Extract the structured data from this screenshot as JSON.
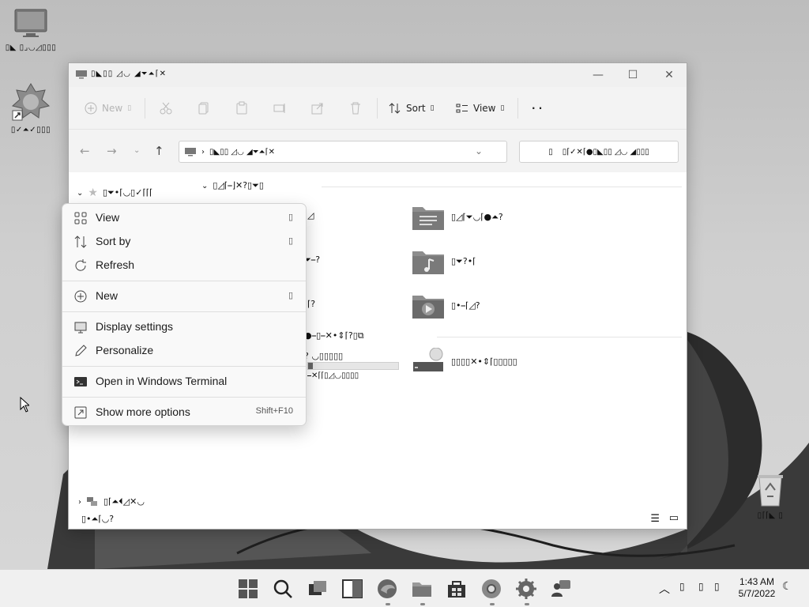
{
  "desktop": {
    "icons": [
      {
        "label": "▯◣ ▯⌟◡◿▯▯▯",
        "name": "this-pc"
      },
      {
        "label": "▯✓⏶✓▯▯▯",
        "name": "user-folder"
      },
      {
        "label": "▯⌈⌈◣ ▯",
        "name": "recycle-bin"
      }
    ]
  },
  "window": {
    "title": "▯◣▯▯ ◿◡ ◢⏷⏶⌈✕",
    "controls": {
      "minimize": "—",
      "maximize": "☐",
      "close": "✕"
    }
  },
  "commandbar": {
    "new_label": "New",
    "new_suffix": "▯",
    "sort_label": "Sort",
    "sort_suffix": "▯",
    "view_label": "View",
    "view_suffix": "▯",
    "more": "· ·"
  },
  "addressbar": {
    "path": "▯◣▯▯ ◿◡ ◢⏷⏶⌈✕",
    "search_placeholder": "▯⌈✓✕⌈●▯◣▯▯ ◿◡ ◢▯▯▯"
  },
  "navpane": {
    "quick_access": "▯⏷•⌈◡▯✓⌈⌈⌈",
    "network": "▯⌈⏶⏴◿✕◡"
  },
  "sections": {
    "folders_header": "▯◿⌈⎯⌋✕?▯⏷▯",
    "drives_header": "●⎯▯⎯✕•⇕⌈?▯⧉",
    "status": "▯•⏶⌈◡?"
  },
  "folders": [
    {
      "name": "▯◿⌈⏷◡⌈●⏶?",
      "icon": "documents-folder-icon"
    },
    {
      "name": "▯⏷?•⌈",
      "icon": "music-folder-icon"
    },
    {
      "name": "▯•⎯⌈◿?",
      "icon": "videos-folder-icon"
    }
  ],
  "partial_left_items": [
    {
      "text": "◿"
    },
    {
      "text": "⏷⎯?"
    },
    {
      "text": "⌈?"
    }
  ],
  "drives": [
    {
      "name": "? ◡▯▯▯▯▯",
      "detail": "⎯✕⌈⌈▯◿◡▯▯▯▯",
      "usage": 0.05
    },
    {
      "name": "▯▯▯▯✕•⇕⌈▯▯▯▯▯",
      "icon": "dvd-drive-icon"
    }
  ],
  "context_menu": {
    "items": [
      {
        "label": "View",
        "right": "▯",
        "icon": "grid-icon"
      },
      {
        "label": "Sort by",
        "right": "▯",
        "icon": "sort-icon"
      },
      {
        "label": "Refresh",
        "right": "",
        "icon": "refresh-icon"
      },
      {
        "label": "New",
        "right": "▯",
        "icon": "plus-circle-icon"
      },
      {
        "label": "Display settings",
        "right": "",
        "icon": "display-icon"
      },
      {
        "label": "Personalize",
        "right": "",
        "icon": "pen-icon"
      },
      {
        "label": "Open in Windows Terminal",
        "right": "",
        "icon": "terminal-icon"
      },
      {
        "label": "Show more options",
        "right": "Shift+F10",
        "icon": "expand-icon"
      }
    ]
  },
  "taskbar": {
    "time": "1:43 AM",
    "date": "5/7/2022"
  }
}
